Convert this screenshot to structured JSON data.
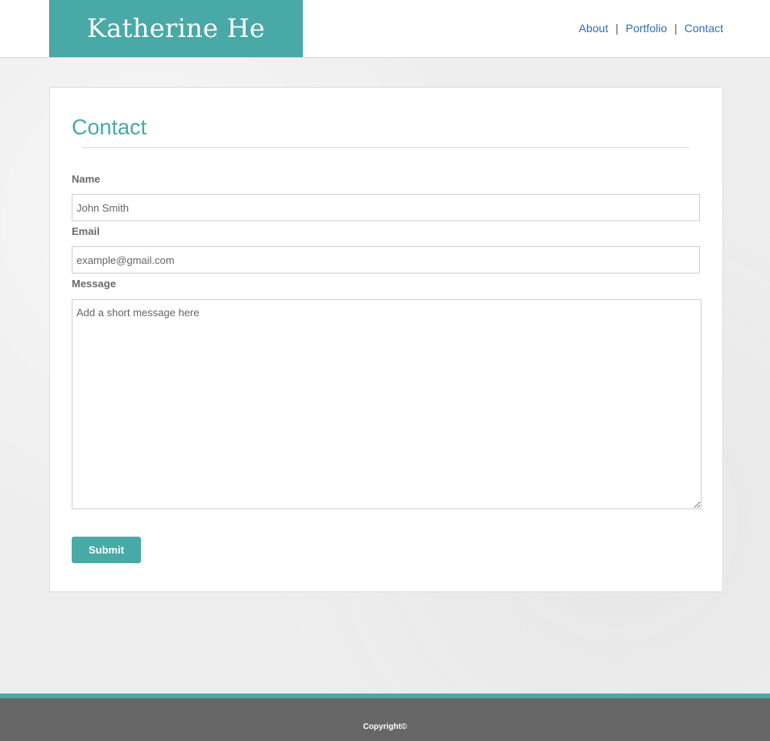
{
  "header": {
    "brand": "Katherine He",
    "nav": [
      {
        "label": "About"
      },
      {
        "label": "Portfolio"
      },
      {
        "label": "Contact"
      }
    ],
    "separator": "|"
  },
  "contact": {
    "title": "Contact",
    "name_label": "Name",
    "name_placeholder": "John Smith",
    "email_label": "Email",
    "email_placeholder": "example@gmail.com",
    "message_label": "Message",
    "message_placeholder": "Add a short message here",
    "submit_label": "Submit"
  },
  "footer": {
    "copyright": "Copyright©"
  },
  "colors": {
    "accent": "#48a9a6",
    "link": "#2f6fb3",
    "footer": "#666666"
  }
}
